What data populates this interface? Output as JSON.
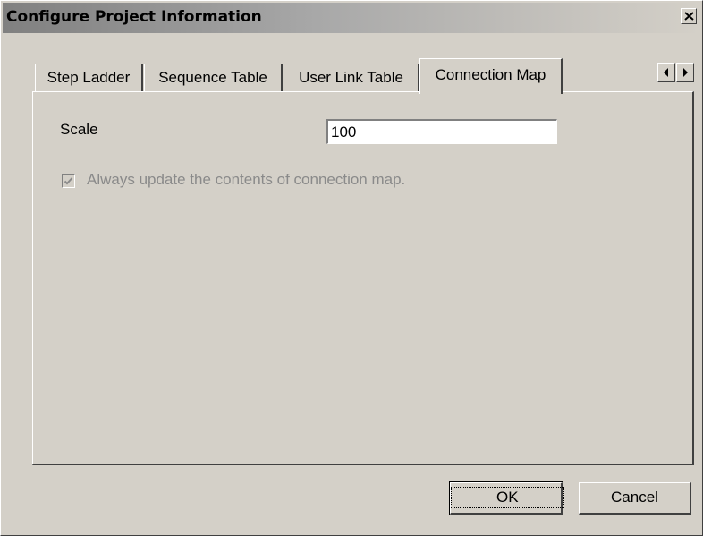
{
  "window": {
    "title": "Configure Project Information"
  },
  "tabs": [
    {
      "label": "Step Ladder",
      "active": false
    },
    {
      "label": "Sequence Table",
      "active": false
    },
    {
      "label": "User Link Table",
      "active": false
    },
    {
      "label": "Connection Map",
      "active": true
    }
  ],
  "connection_map": {
    "scale_label": "Scale",
    "scale_value": "100",
    "always_update_label": "Always update the contents of connection map.",
    "always_update_checked": true,
    "always_update_enabled": false
  },
  "buttons": {
    "ok_label": "OK",
    "cancel_label": "Cancel"
  },
  "icons": {
    "close": "close-icon",
    "tab_scroll_left": "arrow-left-icon",
    "tab_scroll_right": "arrow-right-icon",
    "check": "checkmark-icon"
  }
}
